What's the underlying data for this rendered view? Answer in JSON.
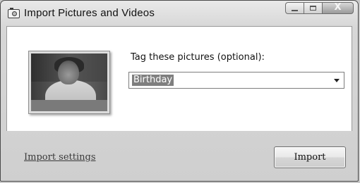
{
  "window": {
    "title": "Import Pictures and Videos"
  },
  "caption_buttons": {
    "close_label": "X"
  },
  "main": {
    "tag_label": "Tag these pictures (optional):",
    "tag_value": "Birthday"
  },
  "footer": {
    "settings_link": "Import settings",
    "import_button": "Import"
  },
  "icons": {
    "app": "camera-icon",
    "thumbnail": "photo-thumbnail",
    "dropdown": "chevron-down-icon"
  }
}
